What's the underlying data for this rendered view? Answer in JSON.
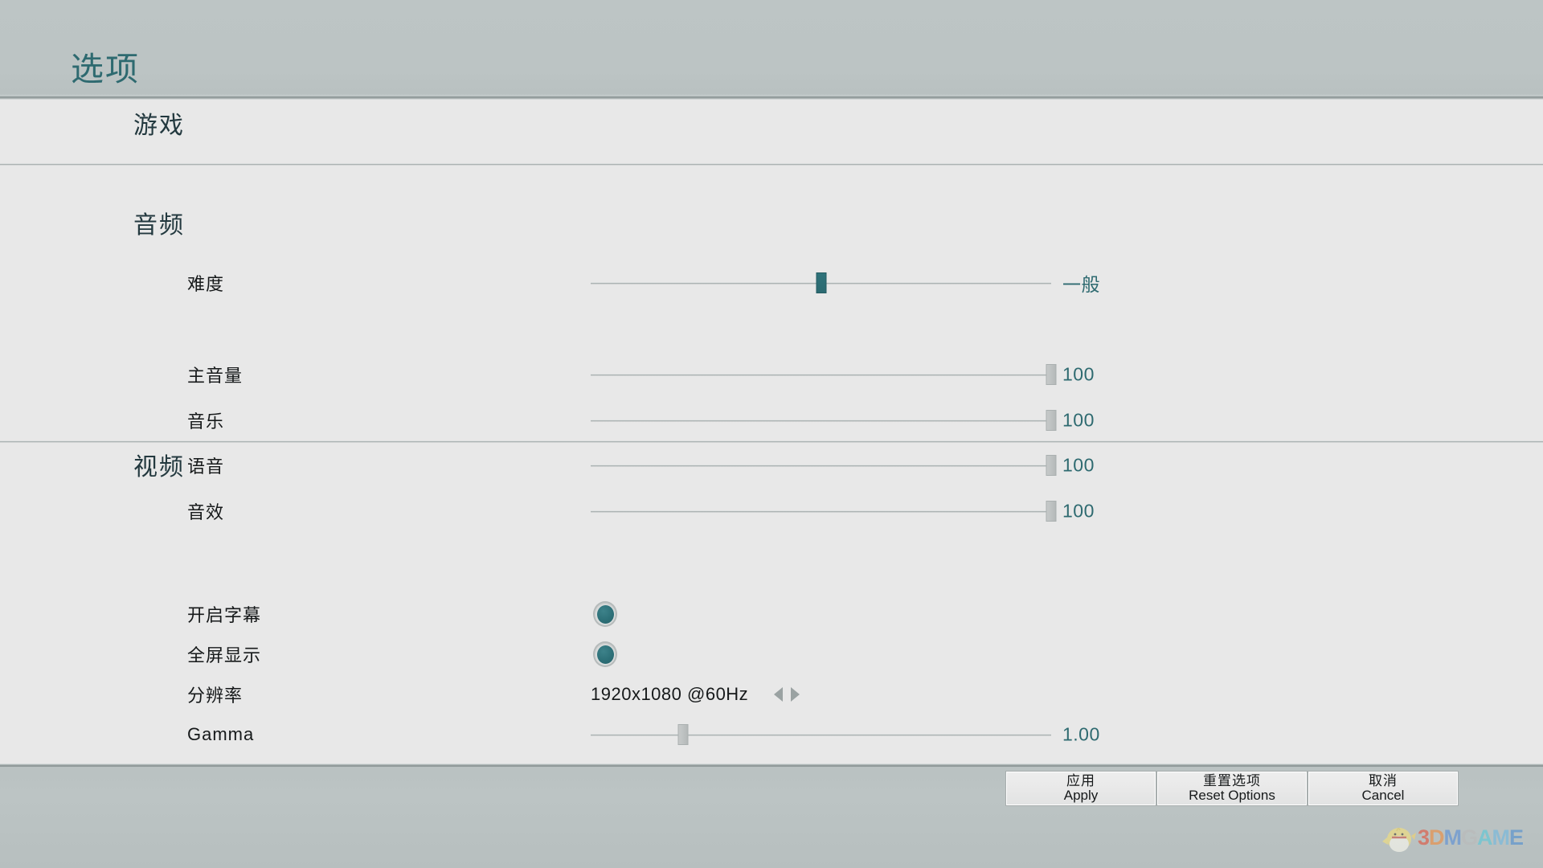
{
  "header": {
    "title": "选项"
  },
  "sections": [
    {
      "id": "game",
      "title": "游戏",
      "rows": [
        {
          "id": "difficulty",
          "label": "难度",
          "control": "slider",
          "value_text": "一般",
          "percent": 50
        }
      ]
    },
    {
      "id": "audio",
      "title": "音频",
      "rows": [
        {
          "id": "master-volume",
          "label": "主音量",
          "control": "slider",
          "value_text": "100",
          "percent": 100
        },
        {
          "id": "music-volume",
          "label": "音乐",
          "control": "slider",
          "value_text": "100",
          "percent": 100
        },
        {
          "id": "voice-volume",
          "label": "语音",
          "control": "slider",
          "value_text": "100",
          "percent": 100
        },
        {
          "id": "sfx-volume",
          "label": "音效",
          "control": "slider",
          "value_text": "100",
          "percent": 100
        }
      ]
    },
    {
      "id": "video",
      "title": "视频",
      "rows": [
        {
          "id": "subtitles",
          "label": "开启字幕",
          "control": "toggle",
          "on": true
        },
        {
          "id": "fullscreen",
          "label": "全屏显示",
          "control": "toggle",
          "on": true
        },
        {
          "id": "resolution",
          "label": "分辨率",
          "control": "stepper",
          "value_text": "1920x1080 @60Hz"
        },
        {
          "id": "gamma",
          "label": "Gamma",
          "control": "slider",
          "value_text": "1.00",
          "percent": 20
        }
      ]
    }
  ],
  "footer": {
    "buttons": [
      {
        "id": "apply",
        "cn": "应用",
        "en": "Apply"
      },
      {
        "id": "reset",
        "cn": "重置选项",
        "en": "Reset Options"
      },
      {
        "id": "cancel",
        "cn": "取消",
        "en": "Cancel"
      }
    ]
  },
  "watermark": {
    "letters": [
      {
        "ch": "3",
        "color": "#e0533c"
      },
      {
        "ch": "D",
        "color": "#ef8b3c"
      },
      {
        "ch": "M",
        "color": "#5a8fd6"
      },
      {
        "ch": "G",
        "color": "#b9b9b9"
      },
      {
        "ch": "A",
        "color": "#5ac8d8"
      },
      {
        "ch": "M",
        "color": "#6fb8e0"
      },
      {
        "ch": "E",
        "color": "#4f8ed0"
      }
    ]
  },
  "colors": {
    "accent_teal": "#2e6a70",
    "header_bg": "#bcc4c4",
    "body_bg": "#e8e8e8",
    "section_title": "#23393f"
  }
}
